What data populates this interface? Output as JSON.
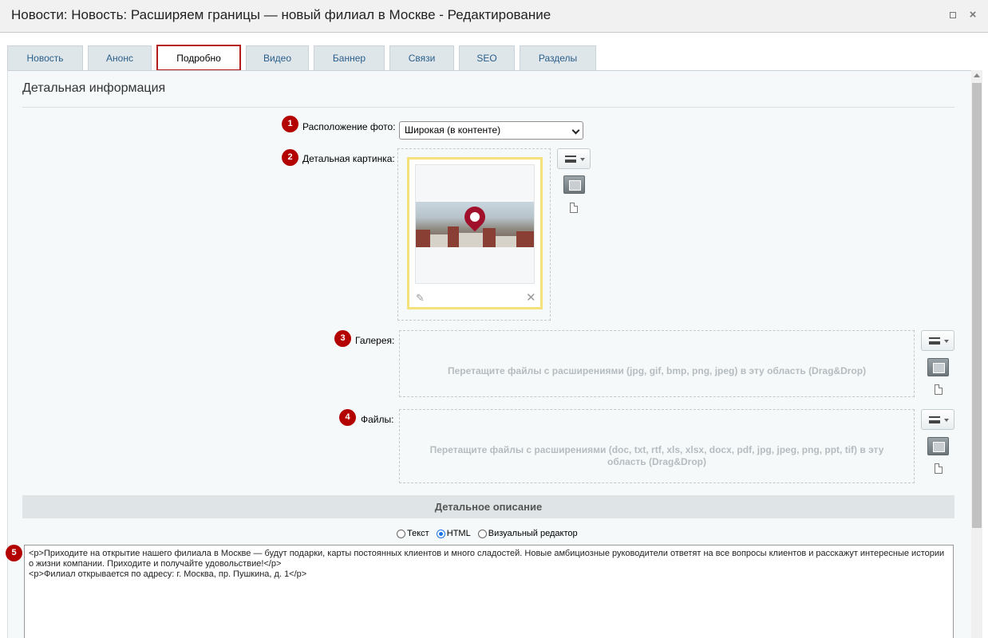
{
  "window": {
    "title": "Новости: Новость: Расширяем границы — новый филиал в Москве - Редактирование"
  },
  "tabs": [
    {
      "label": "Новость"
    },
    {
      "label": "Анонс"
    },
    {
      "label": "Подробно"
    },
    {
      "label": "Видео"
    },
    {
      "label": "Баннер"
    },
    {
      "label": "Связи"
    },
    {
      "label": "SEO"
    },
    {
      "label": "Разделы"
    }
  ],
  "active_tab": "Подробно",
  "section": {
    "title": "Детальная информация"
  },
  "fields": {
    "photo_position": {
      "badge": "1",
      "label": "Расположение фото:",
      "value": "Широкая (в контенте)"
    },
    "detail_image": {
      "badge": "2",
      "label": "Детальная картинка:"
    },
    "gallery": {
      "badge": "3",
      "label": "Галерея:",
      "drop_text": "Перетащите файлы с расширениями (jpg, gif, bmp, png, jpeg) в эту область (Drag&Drop)"
    },
    "files": {
      "badge": "4",
      "label": "Файлы:",
      "drop_text": "Перетащите файлы с расширениями (doc, txt, rtf, xls, xlsx, docx, pdf, jpg, jpeg, png, ppt, tif) в эту область (Drag&Drop)"
    }
  },
  "description": {
    "header": "Детальное описание",
    "badge": "5",
    "modes": [
      "Текст",
      "HTML",
      "Визуальный редактор"
    ],
    "selected_mode": "HTML",
    "content": "<p>Приходите на открытие нашего филиала в Москве — будут подарки, карты постоянных клиентов и много сладостей. Новые амбициозные руководители ответят на все вопросы клиентов и расскажут интересные истории о жизни компании. Приходите и получайте удовольствие!</p>\n<p>Филиал открывается по адресу: г. Москва, пр. Пушкина, д. 1</p>"
  },
  "colors": {
    "badge": "#b30000",
    "active_tab_border": "#b71c1c",
    "tab_bg": "#dfe6ea",
    "tab_text": "#2a5e8a"
  }
}
